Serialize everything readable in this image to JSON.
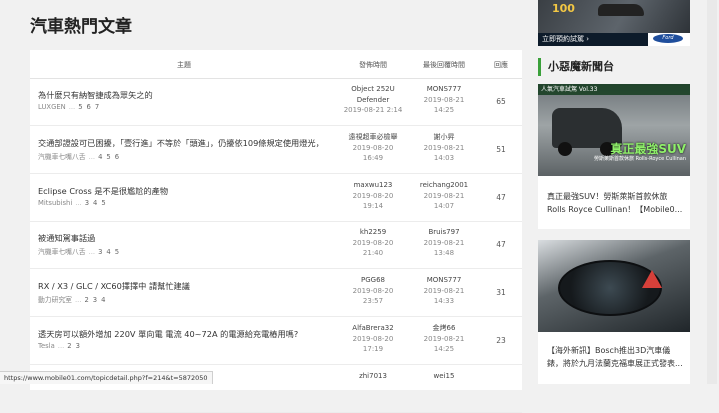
{
  "page_title": "汽車熱門文章",
  "table_header": {
    "subject": "主題",
    "posted": "發佈時間",
    "last_reply": "最後回覆時間",
    "replies": "回應"
  },
  "topics": [
    {
      "title": "為什麼只有納智捷成為眾矢之的",
      "forum": "LUXGEN",
      "dots": "...",
      "pages": [
        "5",
        "6",
        "7"
      ],
      "author": "Object 252U",
      "author_line2": "Defender",
      "post_time": "2019-08-21 2:14",
      "last_user": "MONS777",
      "last_date": "2019-08-21",
      "last_time": "14:25",
      "replies": "65"
    },
    {
      "title": "交通部證設可已困擾，「壹行進」不等於「頭進」，仍擾依109條規定使用燈光，",
      "forum": "汽機車七嘴八舌",
      "dots": "...",
      "pages": [
        "4",
        "5",
        "6"
      ],
      "author": "遠視超車必檢舉",
      "author_line2": "",
      "post_time": "2019-08-20",
      "post_time2": "16:49",
      "last_user": "謝小昇",
      "last_date": "2019-08-21",
      "last_time": "14:03",
      "replies": "51"
    },
    {
      "title": "Eclipse Cross 是不是很尷尬的產物",
      "forum": "Mitsubishi",
      "dots": "...",
      "pages": [
        "3",
        "4",
        "5"
      ],
      "author": "maxwu123",
      "author_line2": "",
      "post_time": "2019-08-20",
      "post_time2": "19:14",
      "last_user": "reichang2001",
      "last_date": "2019-08-21",
      "last_time": "14:07",
      "replies": "47"
    },
    {
      "title": "被通知駕事話過",
      "forum": "汽機車七嘴八舌",
      "dots": "...",
      "pages": [
        "3",
        "4",
        "5"
      ],
      "author": "kh2259",
      "author_line2": "",
      "post_time": "2019-08-20",
      "post_time2": "21:40",
      "last_user": "Bruis797",
      "last_date": "2019-08-21",
      "last_time": "13:48",
      "replies": "47"
    },
    {
      "title": "RX / X3 / GLC / XC60擇擇中 請幫忙建議",
      "forum": "動力研究室",
      "dots": "...",
      "pages": [
        "2",
        "3",
        "4"
      ],
      "author": "PGG68",
      "author_line2": "",
      "post_time": "2019-08-20",
      "post_time2": "23:57",
      "last_user": "MONS777",
      "last_date": "2019-08-21",
      "last_time": "14:33",
      "replies": "31"
    },
    {
      "title": "透天房可以額外增加 220V 單向電 電流 40~72A 的電源給充電樁用嗎?",
      "forum": "Tesla",
      "dots": "...",
      "pages": [
        "2",
        "3"
      ],
      "author": "AlfaBrera32",
      "author_line2": "",
      "post_time": "2019-08-20",
      "post_time2": "17:19",
      "last_user": "金烤66",
      "last_date": "2019-08-21",
      "last_time": "14:25",
      "replies": "23"
    },
    {
      "title": "",
      "forum": "",
      "dots": "",
      "pages": [],
      "author": "zhi7013",
      "author_line2": "",
      "post_time": "",
      "post_time2": "",
      "last_user": "wei15",
      "last_date": "",
      "last_time": "",
      "replies": ""
    }
  ],
  "sidebar": {
    "ad_number": "100",
    "ad_button": "立即預約試駕 ›",
    "ad_brand": "Ford",
    "news_header": "小惡魔新聞台",
    "card1": {
      "tag": "人氣汽車試駕 Vol.33",
      "big": "真正最強SUV",
      "small": "勞斯萊斯首款休旅 Rolls-Royce Cullinan",
      "title": "真正最強SUV！勞斯萊斯首款休旅 Rolls Royce Cullinan！【Mobile0..."
    },
    "card2": {
      "title": "【海外新訊】Bosch推出3D汽車儀錶，將於九月法蘭克福車展正式發表..."
    }
  },
  "status_url": "https://www.mobile01.com/topicdetail.php?f=214&t=5872050",
  "colors": {
    "accent_green": "#3aa03a",
    "background": "#f1f1f1"
  }
}
